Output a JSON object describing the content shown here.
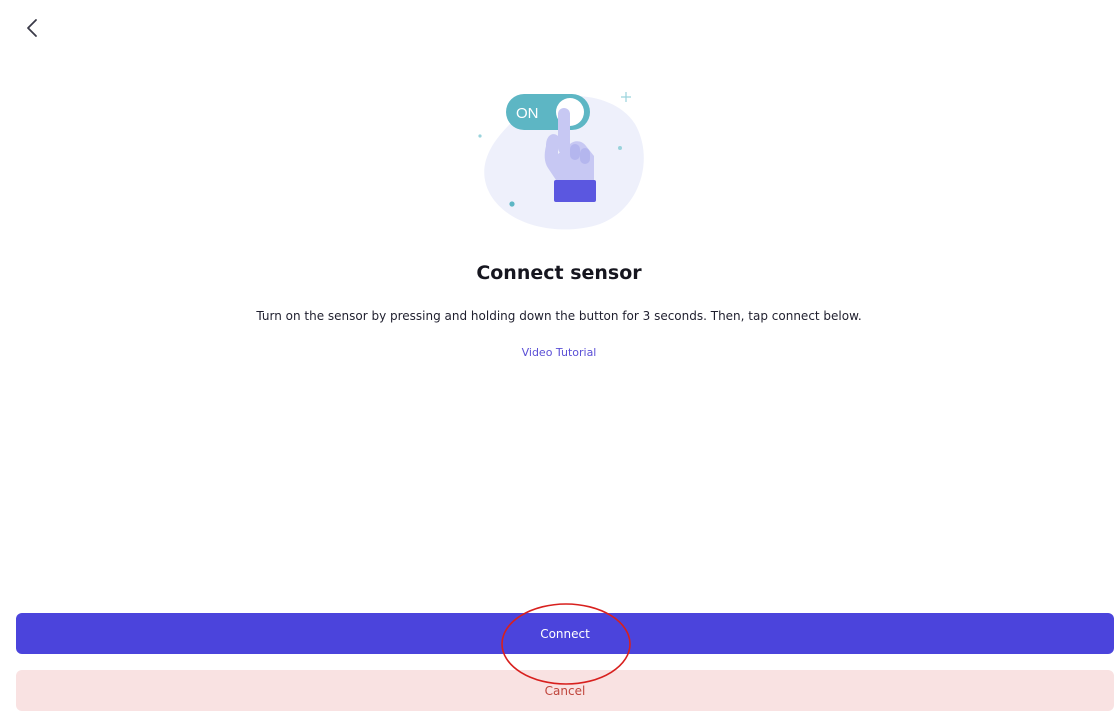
{
  "header": {
    "back_icon": "chevron-left-icon"
  },
  "illustration": {
    "toggle_label": "ON",
    "icon": "hand-pressing-toggle-icon",
    "colors": {
      "toggle": "#5db6c4",
      "blob": "#eef0fb",
      "hand": "#c7c8f3",
      "cuff": "#5b57e0"
    }
  },
  "main": {
    "title": "Connect sensor",
    "instructions": "Turn on the sensor by pressing and holding down the button for 3 seconds. Then, tap connect below.",
    "video_link": "Video Tutorial"
  },
  "actions": {
    "connect_label": "Connect",
    "cancel_label": "Cancel"
  },
  "colors": {
    "primary": "#4b44dc",
    "danger_bg": "#f9e2e2",
    "danger_text": "#c0453c",
    "link": "#5a4fd6",
    "annotation": "#d8201e"
  }
}
